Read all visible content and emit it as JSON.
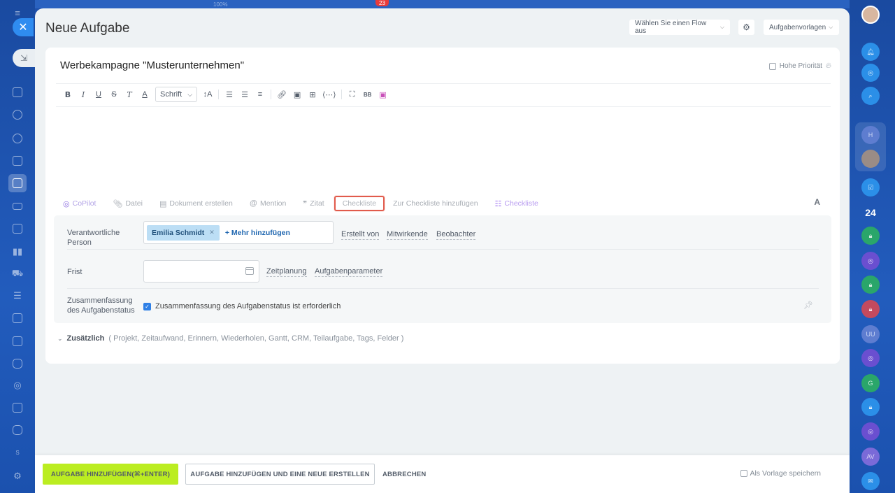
{
  "panel": {
    "title": "Neue Aufgabe",
    "flow_select": "Wählen Sie einen Flow aus",
    "templates_btn": "Aufgabenvorlagen"
  },
  "top_strip": {
    "percent": "100%",
    "badge": "23"
  },
  "task": {
    "title": "Werbekampagne \"Musterunternehmen\"",
    "priority_label": "Hohe Priorität"
  },
  "toolbar": {
    "bold": "B",
    "italic": "I",
    "underline": "U",
    "strike": "S",
    "clear": "T",
    "color": "A",
    "font_select": "Schrift",
    "size": "↕A"
  },
  "bottom_tools": {
    "copilot": "CoPilot",
    "file": "Datei",
    "document": "Dokument erstellen",
    "mention": "Mention",
    "quote": "Zitat",
    "checklist": "Checkliste",
    "add_to_checklist": "Zur Checkliste hinzufügen",
    "checklist_purple": "Checkliste",
    "font_a": "A"
  },
  "fields": {
    "responsible_label": "Verantwortliche Person",
    "responsible_chip": "Emilia Schmidt",
    "add_more": "+ Mehr hinzufügen",
    "created_by": "Erstellt von",
    "participants": "Mitwirkende",
    "observers": "Beobachter",
    "deadline_label": "Frist",
    "deadline_value": "",
    "planning": "Zeitplanung",
    "task_params": "Aufgabenparameter",
    "summary_label": "Zusammenfassung des Aufgabenstatus",
    "summary_check": "Zusammenfassung des Aufgabenstatus ist erforderlich"
  },
  "extra": {
    "label": "Zusätzlich",
    "items": "( Projekt,  Zeitaufwand,  Erinnern,  Wiederholen,  Gantt,  CRM,  Teilaufgabe,  Tags,  Felder )"
  },
  "footer": {
    "primary": "AUFGABE HINZUFÜGEN(⌘+ENTER)",
    "secondary": "AUFGABE HINZUFÜGEN UND EINE NEUE ERSTELLEN",
    "cancel": "ABBRECHEN",
    "save_template": "Als Vorlage speichern"
  },
  "right_rail": {
    "h_initial": "H",
    "count": "24",
    "uu": "UU",
    "g": "G",
    "av": "AV"
  },
  "left_rail": {
    "s_initial": "S"
  },
  "colors": {
    "accent_green": "#bbed21",
    "highlight_red": "#e15b4c",
    "chip_blue": "#bcdef5",
    "link_blue": "#2067b0"
  }
}
